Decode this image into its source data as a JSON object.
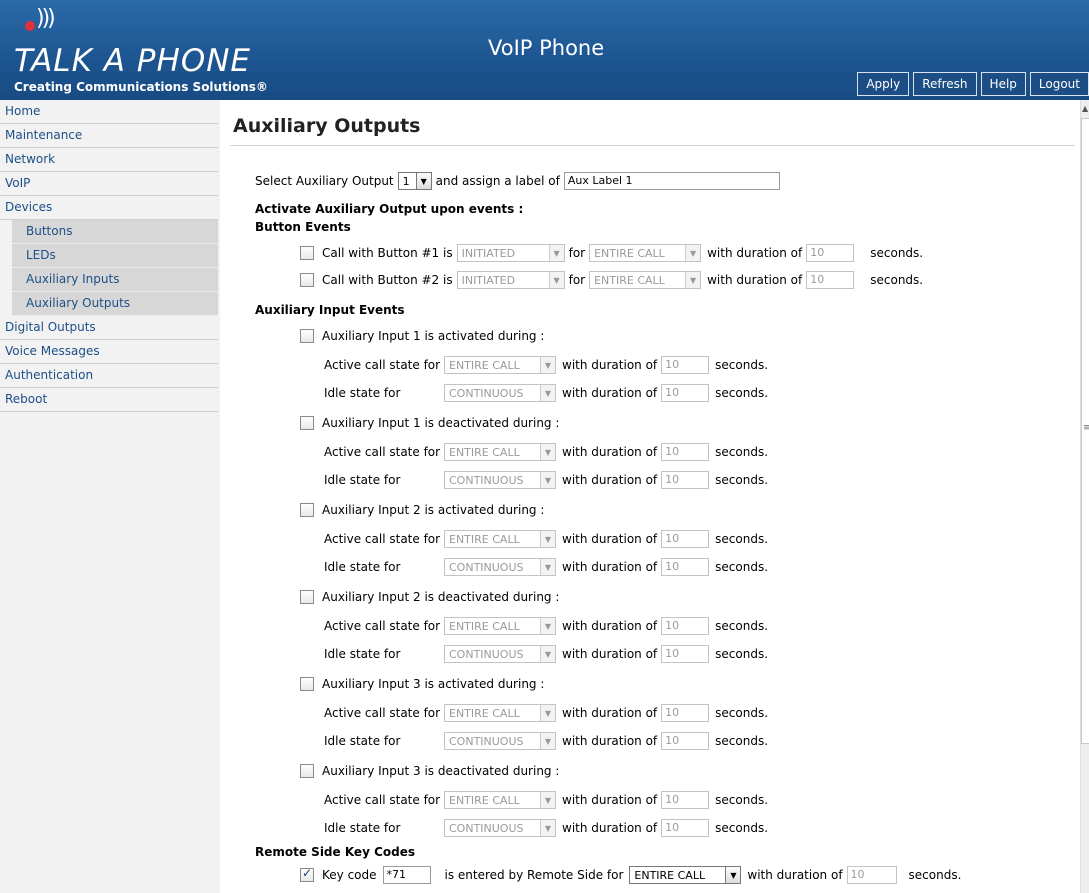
{
  "app": {
    "brand": "TALK A PHONE",
    "tagline": "Creating Communications Solutions®",
    "title": "VoIP Phone"
  },
  "topnav": [
    "Apply",
    "Refresh",
    "Help",
    "Logout"
  ],
  "sidebar": {
    "items": [
      {
        "label": "Home"
      },
      {
        "label": "Maintenance"
      },
      {
        "label": "Network"
      },
      {
        "label": "VoIP"
      },
      {
        "label": "Devices"
      },
      {
        "label": "Buttons"
      },
      {
        "label": "LEDs"
      },
      {
        "label": "Auxiliary Inputs"
      },
      {
        "label": "Auxiliary Outputs"
      },
      {
        "label": "Digital Outputs"
      },
      {
        "label": "Voice Messages"
      },
      {
        "label": "Authentication"
      },
      {
        "label": "Reboot"
      }
    ]
  },
  "main": {
    "page_title": "Auxiliary Outputs",
    "select_prefix": "Select Auxiliary Output",
    "select_value": "1",
    "select_mid": "and assign a label of",
    "label_value": "Aux Label 1",
    "activate_heading": "Activate Auxiliary Output upon events :",
    "button_events_heading": "Button Events",
    "button_events": [
      {
        "text_a": "Call with Button #1 is",
        "state": "INITIATED",
        "for": "for",
        "scope": "ENTIRE CALL",
        "dur_label": "with duration of",
        "duration": "10",
        "unit": "seconds."
      },
      {
        "text_a": "Call with Button #2 is",
        "state": "INITIATED",
        "for": "for",
        "scope": "ENTIRE CALL",
        "dur_label": "with duration of",
        "duration": "10",
        "unit": "seconds."
      }
    ],
    "aux_input_heading": "Auxiliary Input Events",
    "aux_labels": {
      "active_call": "Active call state for",
      "idle": "Idle state for",
      "dur_label": "with duration of",
      "unit": "seconds.",
      "entire_call": "ENTIRE CALL",
      "continuous": "CONTINUOUS",
      "duration": "10"
    },
    "aux_events": [
      "Auxiliary Input 1 is activated during :",
      "Auxiliary Input 1 is deactivated during :",
      "Auxiliary Input 2 is activated during :",
      "Auxiliary Input 2 is deactivated during :",
      "Auxiliary Input 3 is activated during :",
      "Auxiliary Input 3 is deactivated during :"
    ],
    "remote_heading": "Remote Side Key Codes",
    "remote": {
      "checked": true,
      "label": "Key code",
      "code": "*71",
      "mid": "is entered by Remote Side for",
      "scope": "ENTIRE CALL",
      "dur_label": "with duration of",
      "duration": "10",
      "unit": "seconds."
    }
  }
}
